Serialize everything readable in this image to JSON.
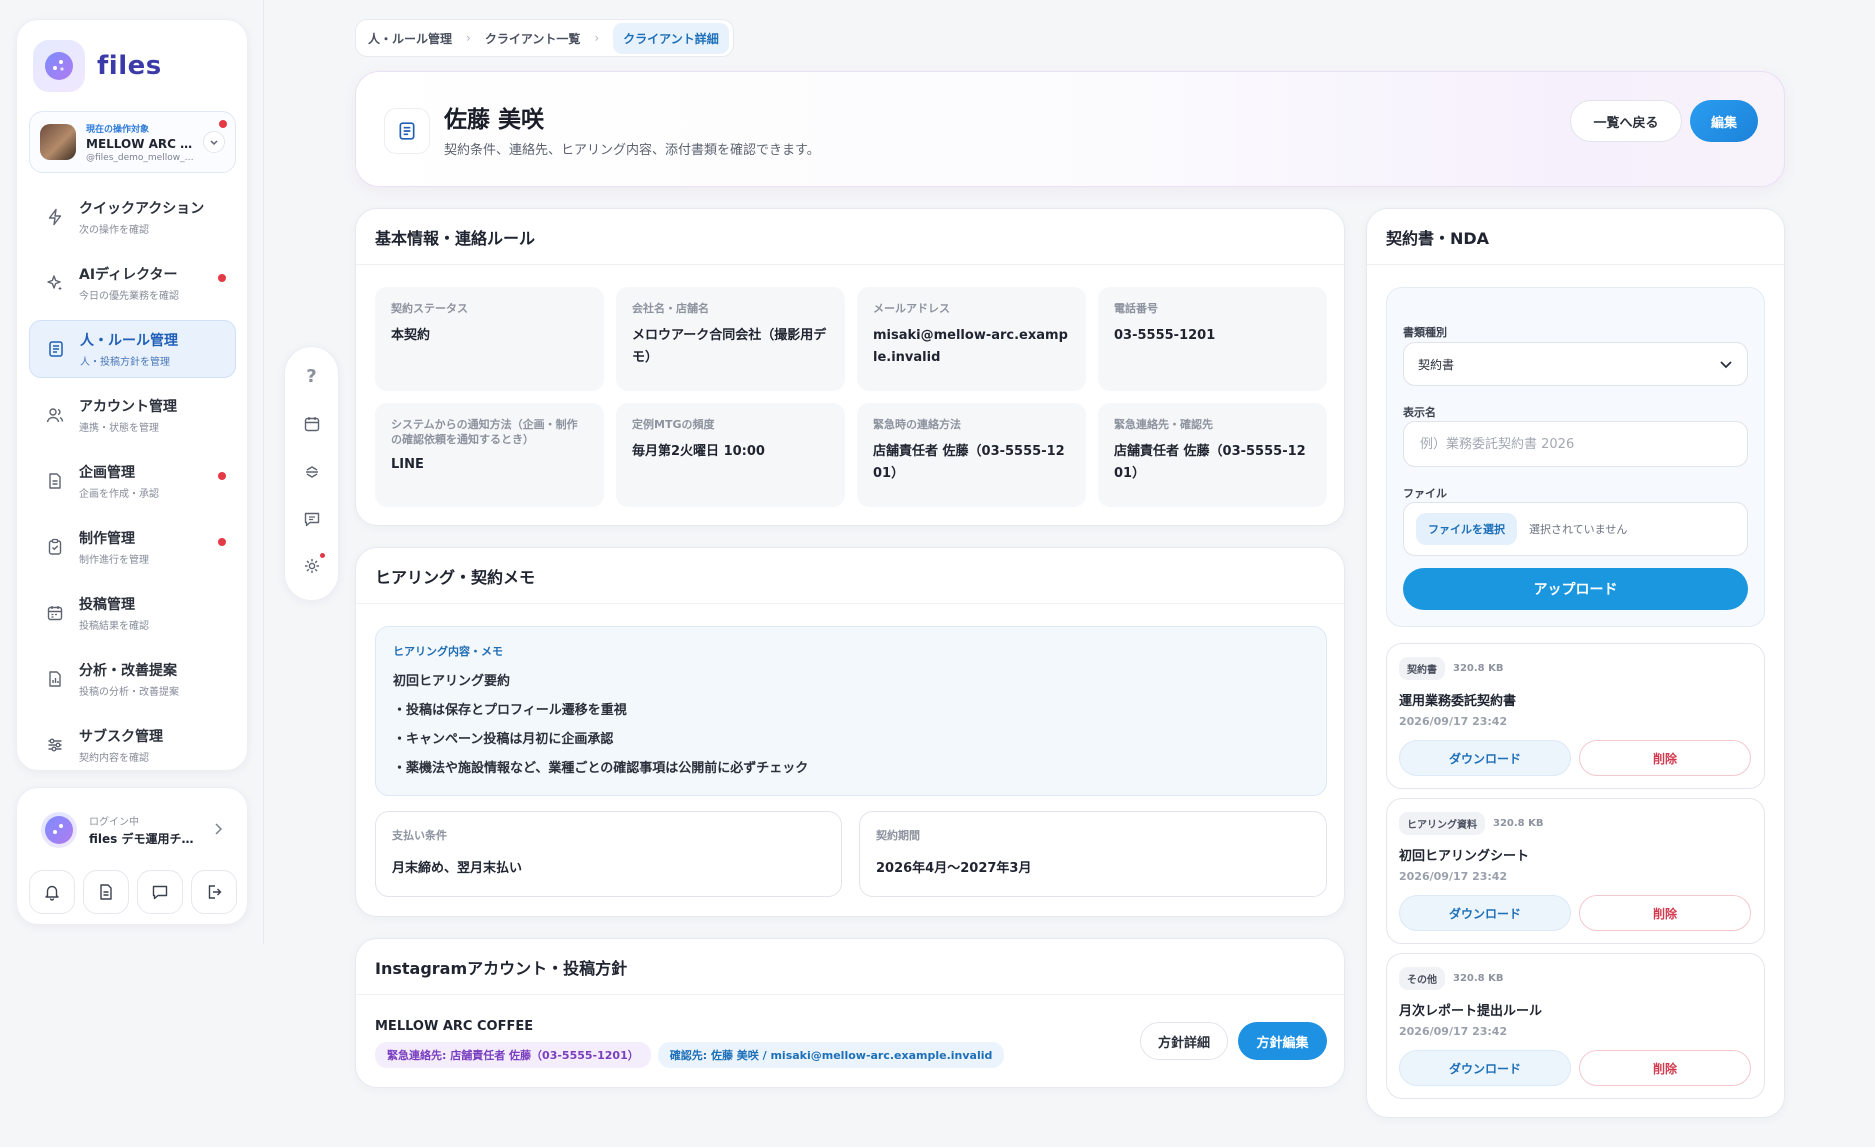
{
  "app": {
    "logo_text": "files"
  },
  "target": {
    "label": "現在の操作対象",
    "name": "MELLOW ARC COFFEE",
    "handle": "@files_demo_mellow_arc"
  },
  "sidebar": {
    "items": [
      {
        "title": "クイックアクション",
        "sub": "次の操作を確認"
      },
      {
        "title": "AIディレクター",
        "sub": "今日の優先業務を確認"
      },
      {
        "title": "人・ルール管理",
        "sub": "人・投稿方針を管理"
      },
      {
        "title": "アカウント管理",
        "sub": "連携・状態を管理"
      },
      {
        "title": "企画管理",
        "sub": "企画を作成・承認"
      },
      {
        "title": "制作管理",
        "sub": "制作進行を管理"
      },
      {
        "title": "投稿管理",
        "sub": "投稿結果を確認"
      },
      {
        "title": "分析・改善提案",
        "sub": "投稿の分析・改善提案"
      },
      {
        "title": "サブスク管理",
        "sub": "契約内容を確認"
      }
    ]
  },
  "user": {
    "label": "ログイン中",
    "name": "files デモ運用チーム"
  },
  "breadcrumb": {
    "items": [
      "人・ルール管理",
      "クライアント一覧",
      "クライアント詳細"
    ]
  },
  "header": {
    "title": "佐藤 美咲",
    "subtitle": "契約条件、連絡先、ヒアリング内容、添付書類を確認できます。",
    "back_label": "一覧へ戻る",
    "edit_label": "編集"
  },
  "basic": {
    "title": "基本情報・連絡ルール",
    "cells": [
      {
        "label": "契約ステータス",
        "value": "本契約"
      },
      {
        "label": "会社名・店舗名",
        "value": "メロウアーク合同会社（撮影用デモ）"
      },
      {
        "label": "メールアドレス",
        "value": "misaki@mellow-arc.example.invalid"
      },
      {
        "label": "電話番号",
        "value": "03-5555-1201"
      },
      {
        "label": "システムからの通知方法（企画・制作の確認依頼を通知するとき）",
        "value": "LINE"
      },
      {
        "label": "定例MTGの頻度",
        "value": "毎月第2火曜日 10:00"
      },
      {
        "label": "緊急時の連絡方法",
        "value": "店舗責任者 佐藤（03-5555-1201）"
      },
      {
        "label": "緊急連絡先・確認先",
        "value": "店舗責任者 佐藤（03-5555-1201）"
      }
    ]
  },
  "hearing": {
    "title": "ヒアリング・契約メモ",
    "memo_label": "ヒアリング内容・メモ",
    "memo_lines": [
      "初回ヒアリング要約",
      "・投稿は保存とプロフィール遷移を重視",
      "・キャンペーン投稿は月初に企画承認",
      "・薬機法や施設情報など、業種ごとの確認事項は公開前に必ずチェック"
    ],
    "payment_label": "支払い条件",
    "payment_value": "月末締め、翌月末払い",
    "period_label": "契約期間",
    "period_value": "2026年4月〜2027年3月"
  },
  "instagram": {
    "title": "Instagramアカウント・投稿方針",
    "account_name": "MELLOW ARC COFFEE",
    "tag_emergency": "緊急連絡先: 店舗責任者 佐藤（03-5555-1201）",
    "tag_confirm": "確認先: 佐藤 美咲 / misaki@mellow-arc.example.invalid",
    "detail_label": "方針詳細",
    "edit_label": "方針編集"
  },
  "contracts": {
    "title": "契約書・NDA",
    "type_label": "書類種別",
    "type_value": "契約書",
    "display_label": "表示名",
    "display_placeholder": "例）業務委託契約書 2026",
    "file_label": "ファイル",
    "file_button": "ファイルを選択",
    "file_status": "選択されていません",
    "upload_label": "アップロード",
    "docs": [
      {
        "type": "契約書",
        "size": "320.8 KB",
        "name": "運用業務委託契約書",
        "date": "2026/09/17 23:42",
        "download": "ダウンロード",
        "delete": "削除"
      },
      {
        "type": "ヒアリング資料",
        "size": "320.8 KB",
        "name": "初回ヒアリングシート",
        "date": "2026/09/17 23:42",
        "download": "ダウンロード",
        "delete": "削除"
      },
      {
        "type": "その他",
        "size": "320.8 KB",
        "name": "月次レポート提出ルール",
        "date": "2026/09/17 23:42",
        "download": "ダウンロード",
        "delete": "削除"
      }
    ]
  },
  "icons": {
    "logo": "dots-logo-icon",
    "nav": [
      "bolt-icon",
      "sparkle-icon",
      "document-list-icon",
      "users-icon",
      "file-icon",
      "clipboard-icon",
      "calendar-icon",
      "chart-file-icon",
      "sliders-icon"
    ],
    "rail": [
      "help-icon",
      "calendar-icon",
      "sort-icon",
      "chat-icon",
      "settings-icon"
    ],
    "user_actions": [
      "bell-icon",
      "document-icon",
      "chat-icon",
      "logout-icon"
    ]
  },
  "colors": {
    "accent": "#1f91e2",
    "alert": "#e53945",
    "active_bg": "#e9f1fd"
  }
}
